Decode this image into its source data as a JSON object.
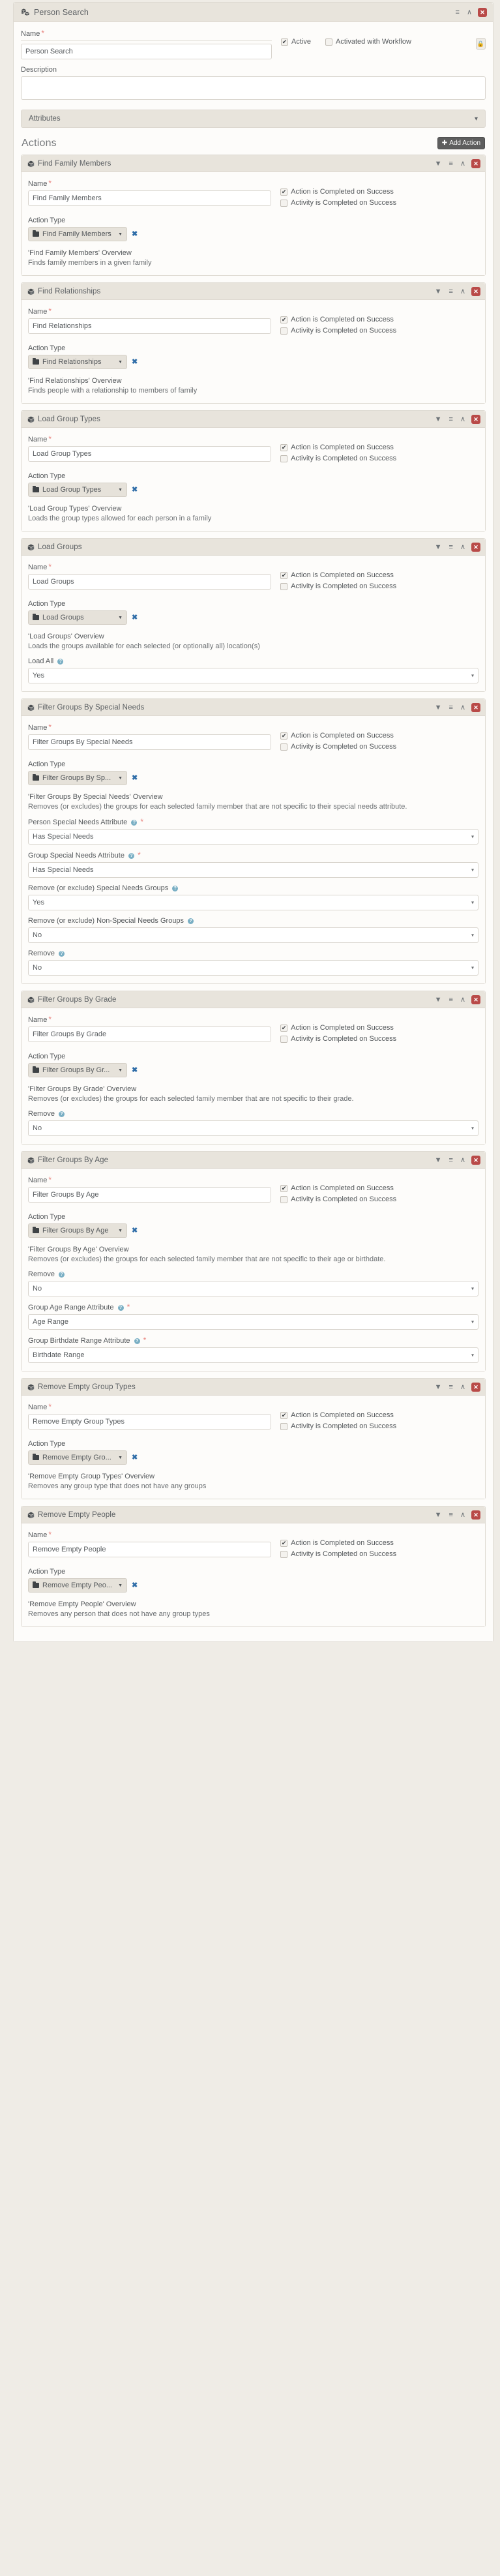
{
  "window": {
    "title": "Person Search",
    "title_icon": "cubes-icon",
    "header_buttons": [
      {
        "name": "reorder-handle",
        "glyph": "≡"
      },
      {
        "name": "collapse-chevron",
        "glyph": "∧"
      },
      {
        "name": "close",
        "glyph": "✕"
      }
    ]
  },
  "form": {
    "name_label": "Name",
    "name_value": "Person Search",
    "name_required": "*",
    "description_label": "Description",
    "description_value": "",
    "active": {
      "label": "Active",
      "checked": true
    },
    "activated_with_workflow": {
      "label": "Activated with Workflow",
      "checked": false
    },
    "security_icon": "lock-icon"
  },
  "attributes": {
    "label": "Attributes",
    "chevron": "⌄"
  },
  "actions_section": {
    "title": "Actions",
    "add_button": "Add Action",
    "add_button_icon": "plus-icon"
  },
  "card_header_icons": [
    {
      "name": "filter-icon",
      "glyph": "▼"
    },
    {
      "name": "reorder-icon",
      "glyph": "≡"
    },
    {
      "name": "collapse-icon",
      "glyph": "∧"
    },
    {
      "name": "delete-icon",
      "glyph": "✕"
    }
  ],
  "labels": {
    "name": "Name",
    "action_type": "Action Type",
    "required_mark": "*",
    "action_completed": "Action is Completed on Success",
    "activity_completed": "Activity is Completed on Success",
    "clear_glyph": "✖"
  },
  "actions": [
    {
      "title": "Find Family Members",
      "name_value": "Find Family Members",
      "action_type_value": "Find Family Members",
      "overview_title": "'Find Family Members' Overview",
      "overview_text": "Finds family members in a given family",
      "action_completed_checked": true,
      "activity_completed_checked": false,
      "fields": []
    },
    {
      "title": "Find Relationships",
      "name_value": "Find Relationships",
      "action_type_value": "Find Relationships",
      "overview_title": "'Find Relationships' Overview",
      "overview_text": "Finds people with a relationship to members of family",
      "action_completed_checked": true,
      "activity_completed_checked": false,
      "fields": []
    },
    {
      "title": "Load Group Types",
      "name_value": "Load Group Types",
      "action_type_value": "Load Group Types",
      "overview_title": "'Load Group Types' Overview",
      "overview_text": "Loads the group types allowed for each person in a family",
      "action_completed_checked": true,
      "activity_completed_checked": false,
      "fields": []
    },
    {
      "title": "Load Groups",
      "name_value": "Load Groups",
      "action_type_value": "Load Groups",
      "overview_title": "'Load Groups' Overview",
      "overview_text": "Loads the groups available for each selected (or optionally all) location(s)",
      "action_completed_checked": true,
      "activity_completed_checked": false,
      "fields": [
        {
          "label": "Load All",
          "help": true,
          "required": false,
          "value": "Yes",
          "options": [
            "Yes",
            "No"
          ]
        }
      ]
    },
    {
      "title": "Filter Groups By Special Needs",
      "name_value": "Filter Groups By Special Needs",
      "action_type_value": "Filter Groups By Sp...",
      "overview_title": "'Filter Groups By Special Needs' Overview",
      "overview_text": "Removes (or excludes) the groups for each selected family member that are not specific to their special needs attribute.",
      "action_completed_checked": true,
      "activity_completed_checked": false,
      "fields": [
        {
          "label": "Person Special Needs Attribute",
          "help": true,
          "required": true,
          "value": "Has Special Needs",
          "options": [
            "Has Special Needs"
          ]
        },
        {
          "label": "Group Special Needs Attribute",
          "help": true,
          "required": true,
          "value": "Has Special Needs",
          "options": [
            "Has Special Needs"
          ]
        },
        {
          "label": "Remove (or exclude) Special Needs Groups",
          "help": true,
          "required": false,
          "value": "Yes",
          "options": [
            "Yes",
            "No"
          ]
        },
        {
          "label": "Remove (or exclude) Non-Special Needs Groups",
          "help": true,
          "required": false,
          "value": "No",
          "options": [
            "Yes",
            "No"
          ]
        },
        {
          "label": "Remove",
          "help": true,
          "required": false,
          "value": "No",
          "options": [
            "Yes",
            "No"
          ]
        }
      ]
    },
    {
      "title": "Filter Groups By Grade",
      "name_value": "Filter Groups By Grade",
      "action_type_value": "Filter Groups By Gr...",
      "overview_title": "'Filter Groups By Grade' Overview",
      "overview_text": "Removes (or excludes) the groups for each selected family member that are not specific to their grade.",
      "action_completed_checked": true,
      "activity_completed_checked": false,
      "fields": [
        {
          "label": "Remove",
          "help": true,
          "required": false,
          "value": "No",
          "options": [
            "Yes",
            "No"
          ]
        }
      ]
    },
    {
      "title": "Filter Groups By Age",
      "name_value": "Filter Groups By Age",
      "action_type_value": "Filter Groups By Age",
      "overview_title": "'Filter Groups By Age' Overview",
      "overview_text": "Removes (or excludes) the groups for each selected family member that are not specific to their age or birthdate.",
      "action_completed_checked": true,
      "activity_completed_checked": false,
      "fields": [
        {
          "label": "Remove",
          "help": true,
          "required": false,
          "value": "No",
          "options": [
            "Yes",
            "No"
          ]
        },
        {
          "label": "Group Age Range Attribute",
          "help": true,
          "required": true,
          "value": "Age Range",
          "options": [
            "Age Range"
          ]
        },
        {
          "label": "Group Birthdate Range Attribute",
          "help": true,
          "required": true,
          "value": "Birthdate Range",
          "options": [
            "Birthdate Range"
          ]
        }
      ]
    },
    {
      "title": "Remove Empty Group Types",
      "name_value": "Remove Empty Group Types",
      "action_type_value": "Remove Empty Gro...",
      "overview_title": "'Remove Empty Group Types' Overview",
      "overview_text": "Removes any group type that does not have any groups",
      "action_completed_checked": true,
      "activity_completed_checked": false,
      "fields": []
    },
    {
      "title": "Remove Empty People",
      "name_value": "Remove Empty People",
      "action_type_value": "Remove Empty Peo...",
      "overview_title": "'Remove Empty People' Overview",
      "overview_text": "Removes any person that does not have any group types",
      "action_completed_checked": true,
      "activity_completed_checked": false,
      "fields": []
    }
  ],
  "colors": {
    "page_bg": "#efece6",
    "panel_bg": "#fdfcfa",
    "header_bg": "#e8e4dc",
    "danger": "#b94a48",
    "link": "#2f6da8",
    "help": "#7aafc4",
    "required": "#e8827c"
  }
}
